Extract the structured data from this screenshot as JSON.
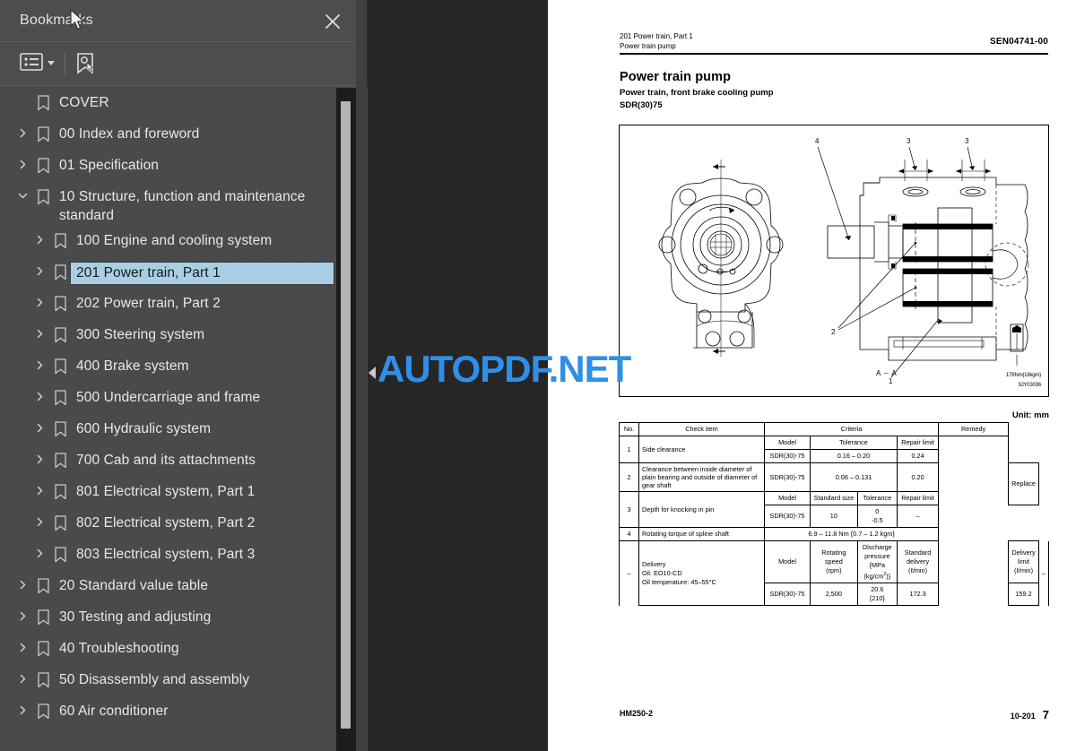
{
  "sidebar": {
    "title": "Bookmarks",
    "close_icon": "close-icon",
    "toolbar": {
      "options_icon": "list-options-icon",
      "new_bookmark_icon": "new-bookmark-icon"
    },
    "items": [
      {
        "label": "COVER",
        "depth": 0,
        "twisty": "none",
        "selected": false
      },
      {
        "label": "00 Index and foreword",
        "depth": 0,
        "twisty": "collapsed",
        "selected": false
      },
      {
        "label": "01 Specification",
        "depth": 0,
        "twisty": "collapsed",
        "selected": false
      },
      {
        "label": "10 Structure, function and maintenance standard",
        "depth": 0,
        "twisty": "expanded",
        "selected": false
      },
      {
        "label": "100 Engine and cooling system",
        "depth": 1,
        "twisty": "collapsed",
        "selected": false
      },
      {
        "label": "201 Power train, Part 1",
        "depth": 1,
        "twisty": "collapsed",
        "selected": true
      },
      {
        "label": "202 Power train, Part 2",
        "depth": 1,
        "twisty": "collapsed",
        "selected": false
      },
      {
        "label": "300 Steering system",
        "depth": 1,
        "twisty": "collapsed",
        "selected": false
      },
      {
        "label": "400 Brake system",
        "depth": 1,
        "twisty": "collapsed",
        "selected": false
      },
      {
        "label": "500 Undercarriage and frame",
        "depth": 1,
        "twisty": "collapsed",
        "selected": false
      },
      {
        "label": "600 Hydraulic system",
        "depth": 1,
        "twisty": "collapsed",
        "selected": false
      },
      {
        "label": "700 Cab and its attachments",
        "depth": 1,
        "twisty": "collapsed",
        "selected": false
      },
      {
        "label": "801 Electrical system, Part 1",
        "depth": 1,
        "twisty": "collapsed",
        "selected": false
      },
      {
        "label": "802 Electrical system, Part 2",
        "depth": 1,
        "twisty": "collapsed",
        "selected": false
      },
      {
        "label": "803 Electrical system, Part 3",
        "depth": 1,
        "twisty": "collapsed",
        "selected": false
      },
      {
        "label": "20 Standard value table",
        "depth": 0,
        "twisty": "collapsed",
        "selected": false
      },
      {
        "label": "30 Testing and adjusting",
        "depth": 0,
        "twisty": "collapsed",
        "selected": false
      },
      {
        "label": "40 Troubleshooting",
        "depth": 0,
        "twisty": "collapsed",
        "selected": false
      },
      {
        "label": "50 Disassembly and assembly",
        "depth": 0,
        "twisty": "collapsed",
        "selected": false
      },
      {
        "label": "60 Air conditioner",
        "depth": 0,
        "twisty": "collapsed",
        "selected": false
      }
    ]
  },
  "viewer": {
    "watermark": "AUTOPDF.NET",
    "watermark_color": "#2f8fe8",
    "collapse_icon": "collapse-panel-arrow-icon"
  },
  "document": {
    "header_line1": "201 Power train, Part 1",
    "header_line2": "Power train pump",
    "header_code": "SEN04741-00",
    "title": "Power train pump",
    "subtitle1": "Power train, front brake cooling pump",
    "subtitle2": "SDR(30)75",
    "figure": {
      "section_label": "A – A",
      "view_mark_top": "A",
      "view_mark_bottom": "A",
      "torque_note": "176Nm{18kgm}",
      "drawing_number": "9JY03036",
      "callouts": [
        "1",
        "2",
        "3",
        "3",
        "4"
      ]
    },
    "unit_note": "Unit: mm",
    "table": {
      "columns": [
        "No.",
        "Check item",
        "Criteria",
        "Remedy"
      ],
      "rows": [
        {
          "no": "1",
          "check_item": "Side clearance",
          "sub_headers": [
            "Model",
            "Tolerance",
            "Repair limit"
          ],
          "values": [
            "SDR(30)-75",
            "0.16 – 0.20",
            "0.24"
          ],
          "remedy": ""
        },
        {
          "no": "2",
          "check_item": "Clearance between inside diameter of plain bearing and outside of diameter of gear shaft",
          "sub_headers": [],
          "values": [
            "SDR(30)-75",
            "0.06 – 0.131",
            "0.20"
          ],
          "remedy": "Replace"
        },
        {
          "no": "3",
          "check_item": "Depth for knocking in pin",
          "sub_headers": [
            "Model",
            "Standard size",
            "Tolerance",
            "Repair limit"
          ],
          "values": [
            "SDR(30)-75",
            "10",
            "0\n-0.5",
            "–"
          ],
          "remedy": ""
        },
        {
          "no": "4",
          "check_item": "Rotating torque of spline shaft",
          "sub_headers": [],
          "values": [
            "6.9 – 11.8 Nm {0.7 – 1.2 kgm}"
          ],
          "remedy": ""
        },
        {
          "no": "–",
          "check_item": "Delivery\nOil: EO10-CD\nOil temperature: 45–55°C",
          "sub_headers": [
            "Model",
            "Rotating speed (rpm)",
            "Discharge pressure {MPa (kg/cm²)}",
            "Standard delivery (ℓ/min)",
            "Delivery limit (ℓ/min)"
          ],
          "values": [
            "SDR(30)-75",
            "2,500",
            "20.6\n{210}",
            "172.3",
            "159.2"
          ],
          "remedy": "–"
        }
      ],
      "cells": {
        "r3_tolerance_top": "0",
        "r3_tolerance_bottom": "-0.5",
        "r5_pressure_top": "20.6",
        "r5_pressure_bottom": "{210}",
        "h_rot_speed_l1": "Rotating",
        "h_rot_speed_l2": "speed",
        "h_rot_speed_l3": "(rpm)",
        "h_disch_l1": "Discharge",
        "h_disch_l2": "pressure",
        "h_disch_l3": "{MPa",
        "h_disch_l4": "(kg/cm",
        "h_disch_l5": ")}",
        "h_std_l1": "Standard",
        "h_std_l2": "delivery",
        "h_std_l3": "(ℓ/min)",
        "h_dlim_l1": "Delivery",
        "h_dlim_l2": "limit",
        "h_dlim_l3": "(ℓ/min)",
        "r5_item_l1": "Delivery",
        "r5_item_l2": "Oil: EO10-CD",
        "r5_item_l3": "Oil temperature: 45–55°C"
      }
    },
    "footer": {
      "model": "HM250-2",
      "section": "10-201",
      "page": "7"
    }
  }
}
